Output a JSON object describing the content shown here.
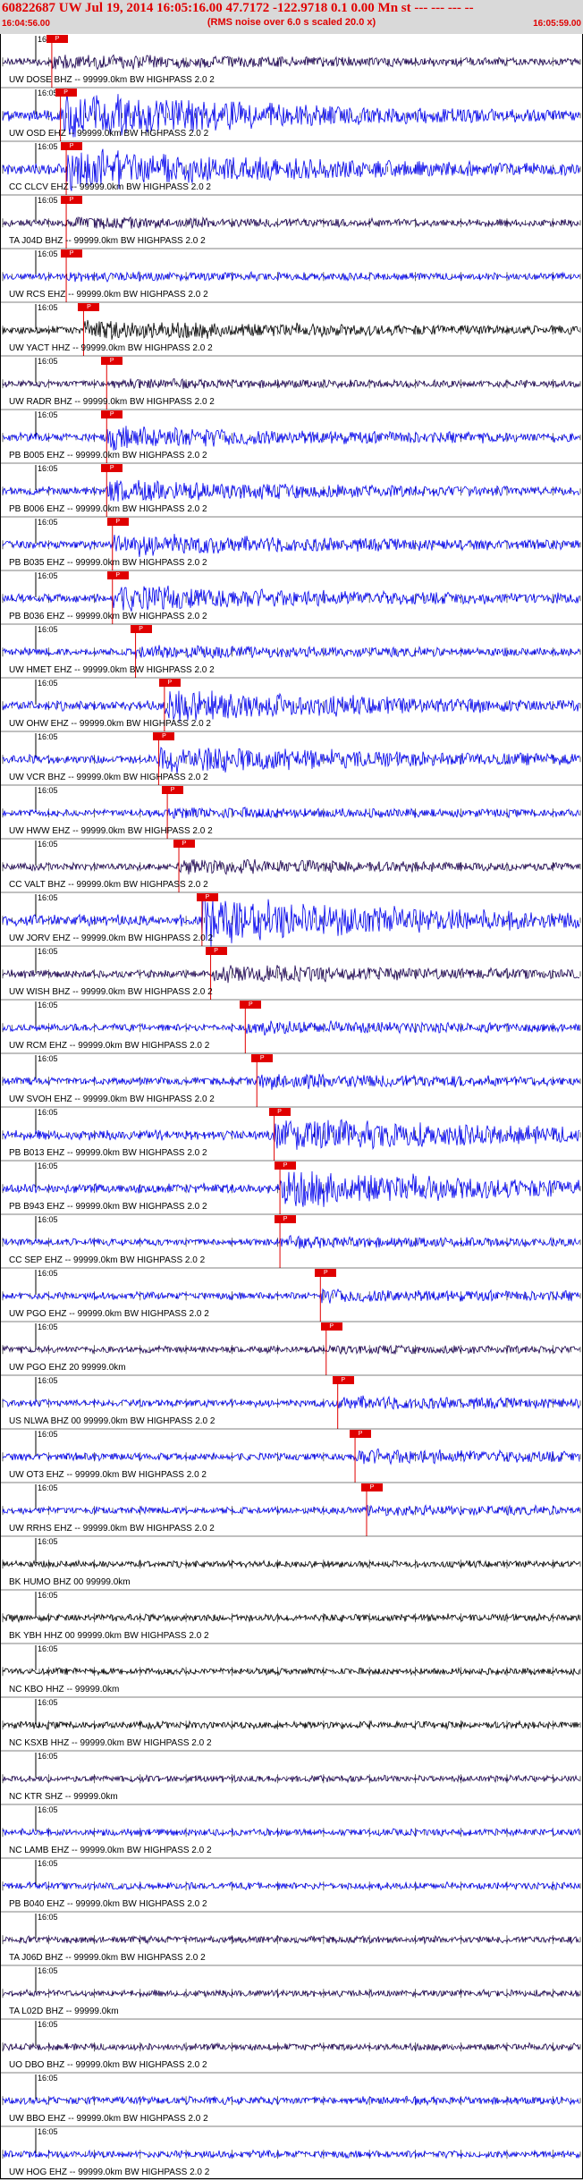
{
  "header": {
    "title": "60822687 UW Jul 19, 2014 16:05:16.00   47.7172 -122.9718  0.1 0.00 Mn st --- --- --- --",
    "subtitle": "(RMS noise over 6.0 s scaled 20.0 x)",
    "start_time": "16:04:56.00",
    "end_time": "16:05:59.00",
    "right_marker": "1"
  },
  "time_tick_label": "16:05",
  "colors": {
    "header_text": "#e00000",
    "header_bg": "#d9d9d9",
    "pick": "#e00000",
    "blue_trace": "#0000ee",
    "dark_trace": "#1a0050"
  },
  "traces": [
    {
      "label": "UW DOSE BHZ -- 99999.0km BW  HIGHPASS  2.0  2",
      "color": "#1a0050",
      "amp": 0.25,
      "pick": 0.085,
      "pick_text": "P"
    },
    {
      "label": "UW OSD EHZ -- 99999.0km BW  HIGHPASS  2.0  2",
      "color": "#0000ee",
      "amp": 0.9,
      "pick": 0.1,
      "pick_text": "P"
    },
    {
      "label": "CC CLCV EHZ -- 99999.0km BW  HIGHPASS  2.0  2",
      "color": "#0000ee",
      "amp": 0.85,
      "pick": 0.11,
      "pick_text": "P"
    },
    {
      "label": "TA J04D BHZ -- 99999.0km BW  HIGHPASS  2.0  2",
      "color": "#1a0050",
      "amp": 0.15,
      "pick": 0.11,
      "pick_text": "P"
    },
    {
      "label": "UW RCS EHZ -- 99999.0km BW  HIGHPASS  2.0  2",
      "color": "#0000ee",
      "amp": 0.1,
      "pick": 0.11,
      "pick_text": "P"
    },
    {
      "label": "UW YACT HHZ -- 99999.0km BW  HIGHPASS  2.0  2",
      "color": "#000000",
      "amp": 0.35,
      "pick": 0.14,
      "pick_text": "P"
    },
    {
      "label": "UW RADR BHZ -- 99999.0km BW  HIGHPASS  2.0  2",
      "color": "#1a0050",
      "amp": 0.1,
      "pick": 0.18,
      "pick_text": "P"
    },
    {
      "label": "PB B005 EHZ -- 99999.0km BW  HIGHPASS  2.0  2",
      "color": "#0000ee",
      "amp": 0.4,
      "pick": 0.18,
      "pick_text": "P"
    },
    {
      "label": "PB B006 EHZ -- 99999.0km BW  HIGHPASS  2.0  2",
      "color": "#0000ee",
      "amp": 0.4,
      "pick": 0.18,
      "pick_text": "P"
    },
    {
      "label": "PB B035 EHZ -- 99999.0km BW  HIGHPASS  2.0  2",
      "color": "#0000ee",
      "amp": 0.4,
      "pick": 0.19,
      "pick_text": "P"
    },
    {
      "label": "PB B036 EHZ -- 99999.0km BW  HIGHPASS  2.0  2",
      "color": "#0000ee",
      "amp": 0.5,
      "pick": 0.19,
      "pick_text": "P"
    },
    {
      "label": "UW HMET EHZ -- 99999.0km BW  HIGHPASS  2.0  2",
      "color": "#0000ee",
      "amp": 0.2,
      "pick": 0.23,
      "pick_text": "P"
    },
    {
      "label": "UW OHW EHZ -- 99999.0km BW  HIGHPASS  2.0  2",
      "color": "#0000ee",
      "amp": 0.6,
      "pick": 0.28,
      "pick_text": "P"
    },
    {
      "label": "UW VCR BHZ -- 99999.0km BW  HIGHPASS  2.0  2",
      "color": "#0000ee",
      "amp": 0.55,
      "pick": 0.27,
      "pick_text": "P"
    },
    {
      "label": "UW HWW EHZ -- 99999.0km BW  HIGHPASS  2.0  2",
      "color": "#0000ee",
      "amp": 0.15,
      "pick": 0.285,
      "pick_text": "P"
    },
    {
      "label": "CC VALT BHZ -- 99999.0km BW  HIGHPASS  2.0  2",
      "color": "#1a0050",
      "amp": 0.25,
      "pick": 0.305,
      "pick_text": "P"
    },
    {
      "label": "UW JORV EHZ -- 99999.0km BW  HIGHPASS  2.0  2",
      "color": "#0000ee",
      "amp": 0.95,
      "pick": 0.345,
      "pick_text": "P"
    },
    {
      "label": "UW WISH BHZ -- 99999.0km BW  HIGHPASS  2.0  2",
      "color": "#1a0050",
      "amp": 0.3,
      "pick": 0.36,
      "pick_text": "P"
    },
    {
      "label": "UW RCM EHZ -- 99999.0km BW  HIGHPASS  2.0  2",
      "color": "#0000ee",
      "amp": 0.2,
      "pick": 0.42,
      "pick_text": "P"
    },
    {
      "label": "UW SVOH EHZ -- 99999.0km BW  HIGHPASS  2.0  2",
      "color": "#0000ee",
      "amp": 0.25,
      "pick": 0.44,
      "pick_text": "P"
    },
    {
      "label": "PB B013 EHZ -- 99999.0km BW  HIGHPASS  2.0  2",
      "color": "#0000ee",
      "amp": 0.7,
      "pick": 0.47,
      "pick_text": "P"
    },
    {
      "label": "PB B943 EHZ -- 99999.0km BW  HIGHPASS  2.0  2",
      "color": "#0000ee",
      "amp": 0.75,
      "pick": 0.48,
      "pick_text": "P"
    },
    {
      "label": "CC SEP EHZ -- 99999.0km BW  HIGHPASS  2.0  2",
      "color": "#0000ee",
      "amp": 0.15,
      "pick": 0.48,
      "pick_text": "P"
    },
    {
      "label": "UW PGO EHZ -- 99999.0km BW  HIGHPASS  2.0  2",
      "color": "#0000ee",
      "amp": 0.2,
      "pick": 0.55,
      "pick_text": "P"
    },
    {
      "label": "UW PGO EHZ 20 99999.0km",
      "color": "#1a0050",
      "amp": 0.08,
      "pick": 0.56,
      "pick_text": "P"
    },
    {
      "label": "US NLWA BHZ 00 99999.0km BW  HIGHPASS  2.0  2",
      "color": "#0000ee",
      "amp": 0.2,
      "pick": 0.58,
      "pick_text": "P"
    },
    {
      "label": "UW OT3 EHZ -- 99999.0km BW  HIGHPASS  2.0  2",
      "color": "#0000ee",
      "amp": 0.25,
      "pick": 0.61,
      "pick_text": "P"
    },
    {
      "label": "UW RRHS EHZ -- 99999.0km BW  HIGHPASS  2.0  2",
      "color": "#0000ee",
      "amp": 0.12,
      "pick": 0.63,
      "pick_text": "P"
    },
    {
      "label": "BK HUMO BHZ 00 99999.0km",
      "color": "#000000",
      "amp": 0.04,
      "pick": -1,
      "pick_text": ""
    },
    {
      "label": "BK YBH HHZ 00 99999.0km BW  HIGHPASS  2.0  2",
      "color": "#000000",
      "amp": 0.25,
      "pick": -1,
      "pick_text": ""
    },
    {
      "label": "NC KBO HHZ -- 99999.0km",
      "color": "#000000",
      "amp": 0.05,
      "pick": -1,
      "pick_text": ""
    },
    {
      "label": "NC KSXB HHZ -- 99999.0km BW  HIGHPASS  2.0  2",
      "color": "#000000",
      "amp": 0.22,
      "pick": -1,
      "pick_text": ""
    },
    {
      "label": "NC KTR SHZ -- 99999.0km",
      "color": "#1a0050",
      "amp": 0.03,
      "pick": -1,
      "pick_text": ""
    },
    {
      "label": "NC LAMB EHZ -- 99999.0km BW  HIGHPASS  2.0  2",
      "color": "#0000ee",
      "amp": 0.12,
      "pick": -1,
      "pick_text": ""
    },
    {
      "label": "PB B040 EHZ -- 99999.0km BW  HIGHPASS  2.0  2",
      "color": "#0000ee",
      "amp": 0.15,
      "pick": -1,
      "pick_text": ""
    },
    {
      "label": "TA J06D BHZ -- 99999.0km BW  HIGHPASS  2.0  2",
      "color": "#1a0050",
      "amp": 0.12,
      "pick": -1,
      "pick_text": ""
    },
    {
      "label": "TA L02D BHZ -- 99999.0km",
      "color": "#1a0050",
      "amp": 0.08,
      "pick": -1,
      "pick_text": ""
    },
    {
      "label": "UO DBO BHZ -- 99999.0km BW  HIGHPASS  2.0  2",
      "color": "#1a0050",
      "amp": 0.15,
      "pick": -1,
      "pick_text": ""
    },
    {
      "label": "UW BBO EHZ -- 99999.0km BW  HIGHPASS  2.0  2",
      "color": "#0000ee",
      "amp": 0.35,
      "pick": -1,
      "pick_text": ""
    },
    {
      "label": "UW HOG EHZ -- 99999.0km BW  HIGHPASS  2.0  2",
      "color": "#0000ee",
      "amp": 0.2,
      "pick": -1,
      "pick_text": ""
    }
  ]
}
